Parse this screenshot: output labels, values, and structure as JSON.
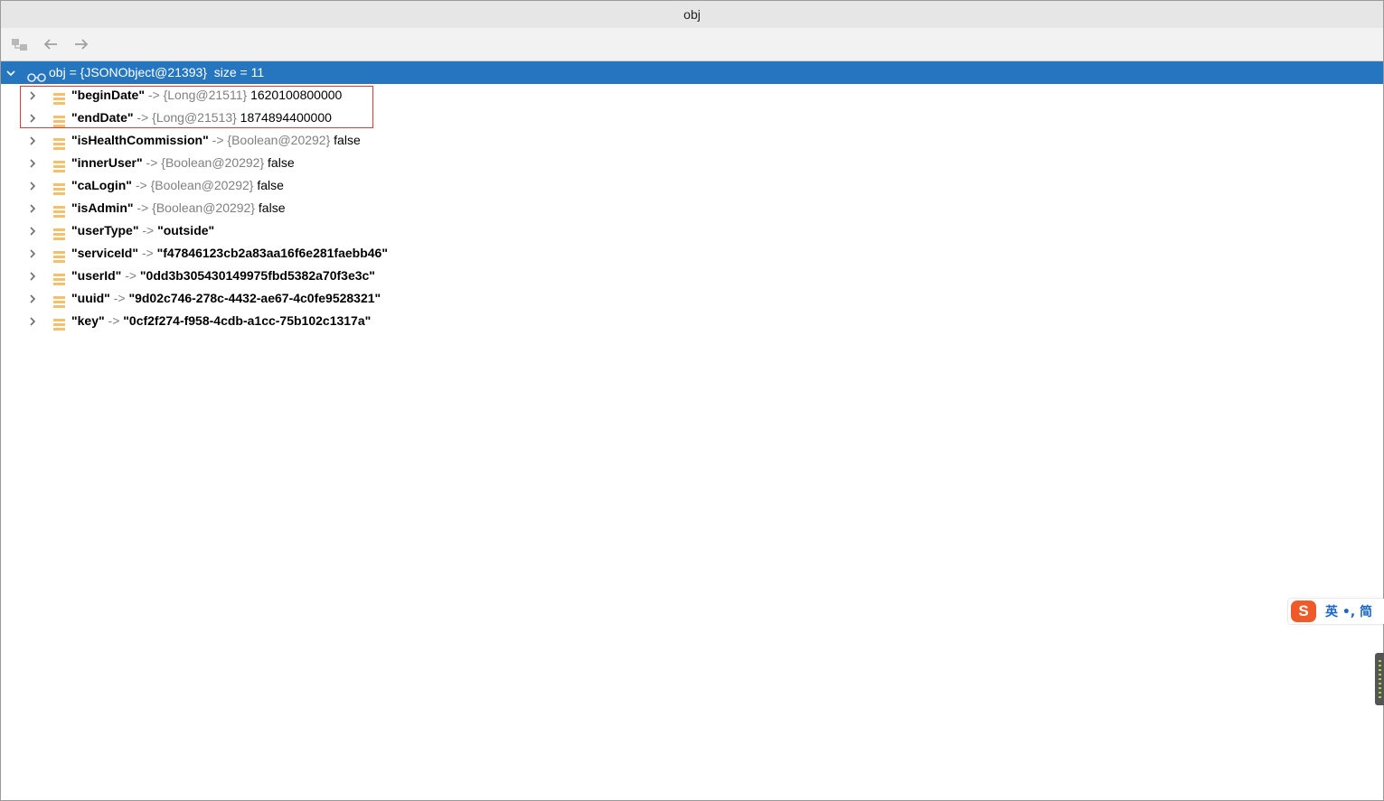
{
  "window": {
    "title": "obj"
  },
  "toolbar": {
    "buttons": [
      {
        "name": "hierarchy-icon"
      },
      {
        "name": "back-arrow-icon"
      },
      {
        "name": "forward-arrow-icon"
      }
    ]
  },
  "tree": {
    "root": {
      "name": "obj",
      "eq": "=",
      "type": "{JSONObject@21393}",
      "size": "size = 11"
    },
    "children": [
      {
        "key": "\"beginDate\"",
        "arrow": "->",
        "type": "{Long@21511}",
        "value": "1620100800000",
        "string": false
      },
      {
        "key": "\"endDate\"",
        "arrow": "->",
        "type": "{Long@21513}",
        "value": "1874894400000",
        "string": false
      },
      {
        "key": "\"isHealthCommission\"",
        "arrow": "->",
        "type": "{Boolean@20292}",
        "value": "false",
        "string": false
      },
      {
        "key": "\"innerUser\"",
        "arrow": "->",
        "type": "{Boolean@20292}",
        "value": "false",
        "string": false
      },
      {
        "key": "\"caLogin\"",
        "arrow": "->",
        "type": "{Boolean@20292}",
        "value": "false",
        "string": false
      },
      {
        "key": "\"isAdmin\"",
        "arrow": "->",
        "type": "{Boolean@20292}",
        "value": "false",
        "string": false
      },
      {
        "key": "\"userType\"",
        "arrow": "->",
        "type": "",
        "value": "\"outside\"",
        "string": true
      },
      {
        "key": "\"serviceId\"",
        "arrow": "->",
        "type": "",
        "value": "\"f47846123cb2a83aa16f6e281faebb46\"",
        "string": true
      },
      {
        "key": "\"userId\"",
        "arrow": "->",
        "type": "",
        "value": "\"0dd3b305430149975fbd5382a70f3e3c\"",
        "string": true
      },
      {
        "key": "\"uuid\"",
        "arrow": "->",
        "type": "",
        "value": "\"9d02c746-278c-4432-ae67-4c0fe9528321\"",
        "string": true
      },
      {
        "key": "\"key\"",
        "arrow": "->",
        "type": "",
        "value": "\"0cf2f274-f958-4cdb-a1cc-75b102c1317a\"",
        "string": true
      }
    ]
  },
  "ime": {
    "logo": "S",
    "text": "英 •, 简"
  },
  "colors": {
    "selection": "#2675bf",
    "highlight_box": "#e53935",
    "field_icon": "#f5c06b"
  }
}
